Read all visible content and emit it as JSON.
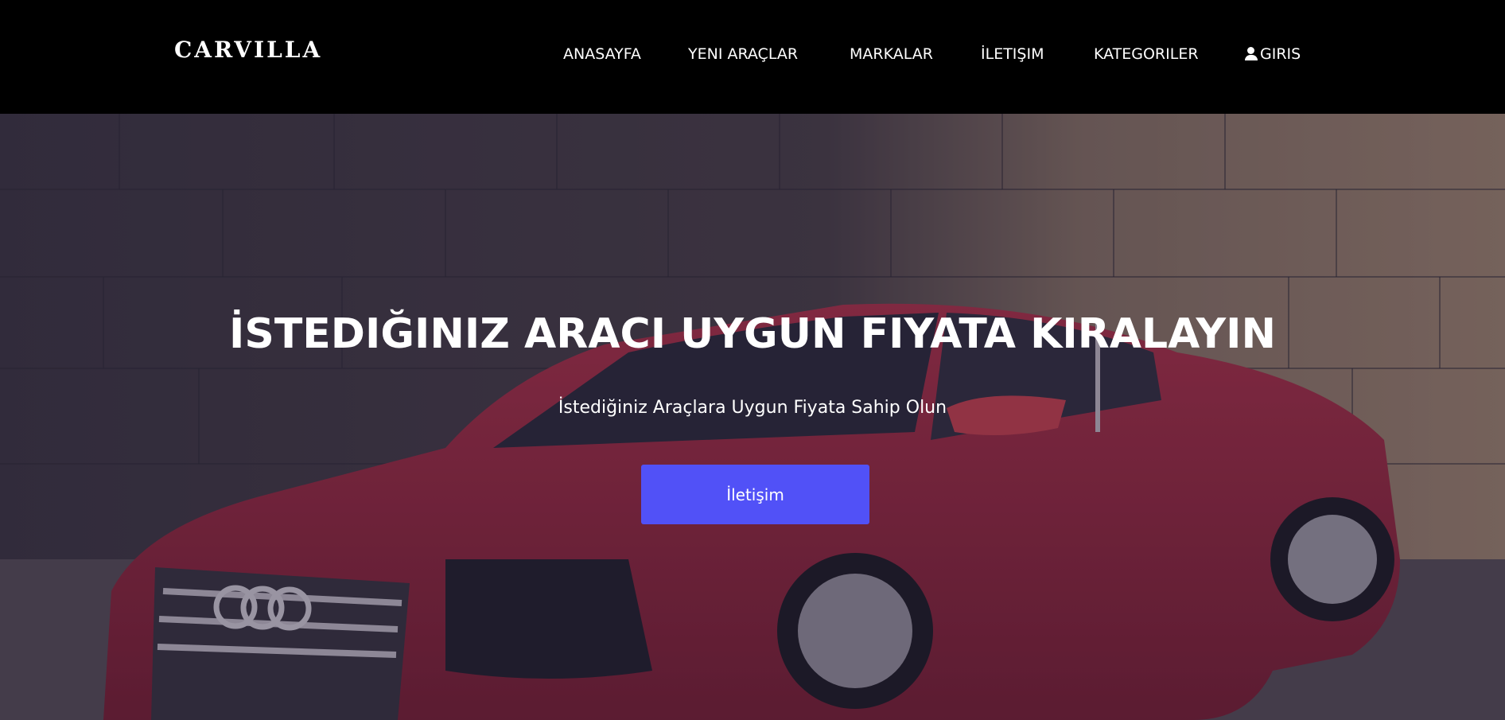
{
  "brand": {
    "name": "CARVILLA"
  },
  "nav": {
    "items": [
      {
        "label": "ANASAYFA"
      },
      {
        "label": "YENI ARAÇLAR"
      },
      {
        "label": "MARKALAR"
      },
      {
        "label": "İLETIŞIM"
      },
      {
        "label": "KATEGORILER"
      }
    ],
    "login": {
      "label": "GIRIS",
      "icon": "user-icon"
    }
  },
  "hero": {
    "title": "İSTEDIĞINIZ ARACI UYGUN FIYATA KIRALAYIN",
    "subtitle": "İstediğiniz Araçlara Uygun Fiyata Sahip Olun",
    "button_label": "İletişim"
  },
  "colors": {
    "nav_background": "#000000",
    "button_accent": "#5151f7",
    "text": "#ffffff"
  }
}
